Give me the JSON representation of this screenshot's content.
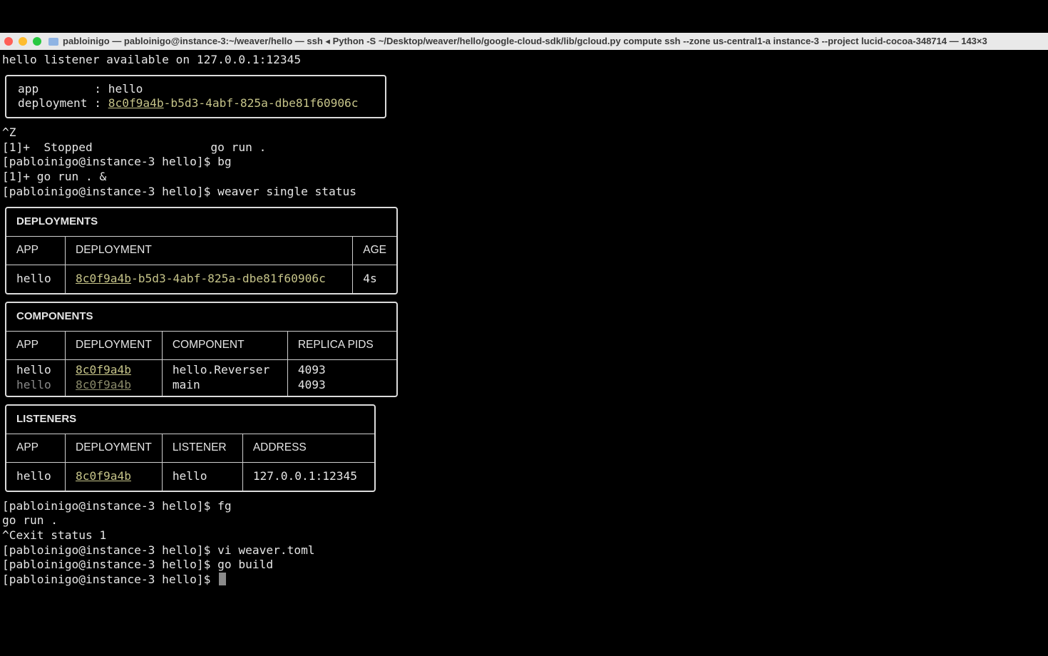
{
  "window": {
    "title": "pabloinigo — pabloinigo@instance-3:~/weaver/hello — ssh ◂ Python -S ~/Desktop/weaver/hello/google-cloud-sdk/lib/gcloud.py compute ssh --zone us-central1-a instance-3 --project lucid-cocoa-348714 — 143×3"
  },
  "lines_before": {
    "listener": "hello listener available on 127.0.0.1:12345"
  },
  "app_box": {
    "app_key": "app        : ",
    "app_val": "hello",
    "dep_key": "deployment : ",
    "dep_short": "8c0f9a4b",
    "dep_rest": "-b5d3-4abf-825a-dbe81f60906c"
  },
  "lines_mid": {
    "l1": "^Z",
    "l2": "[1]+  Stopped                 go run .",
    "l3": "[pabloinigo@instance-3 hello]$ bg",
    "l4": "[1]+ go run . &",
    "l5": "[pabloinigo@instance-3 hello]$ weaver single status"
  },
  "deployments": {
    "title": "DEPLOYMENTS",
    "headers": [
      "APP",
      "DEPLOYMENT",
      "AGE"
    ],
    "row": {
      "app": "hello",
      "dep_short": "8c0f9a4b",
      "dep_rest": "-b5d3-4abf-825a-dbe81f60906c",
      "age": "4s"
    }
  },
  "components": {
    "title": "COMPONENTS",
    "headers": [
      "APP",
      "DEPLOYMENT",
      "COMPONENT",
      "REPLICA PIDS"
    ],
    "rows": [
      {
        "app": "hello",
        "dep": "8c0f9a4b",
        "component": "hello.Reverser",
        "pids": "4093"
      },
      {
        "app": "hello",
        "dep": "8c0f9a4b",
        "component": "main",
        "pids": "4093"
      }
    ]
  },
  "listeners": {
    "title": "LISTENERS",
    "headers": [
      "APP",
      "DEPLOYMENT",
      "LISTENER",
      "ADDRESS"
    ],
    "row": {
      "app": "hello",
      "dep": "8c0f9a4b",
      "listener": "hello",
      "address": "127.0.0.1:12345"
    }
  },
  "lines_after": {
    "l1": "[pabloinigo@instance-3 hello]$ fg",
    "l2": "go run .",
    "l3": "^Cexit status 1",
    "l4": "[pabloinigo@instance-3 hello]$ vi weaver.toml",
    "l5": "[pabloinigo@instance-3 hello]$ go build",
    "prompt": "[pabloinigo@instance-3 hello]$ "
  }
}
